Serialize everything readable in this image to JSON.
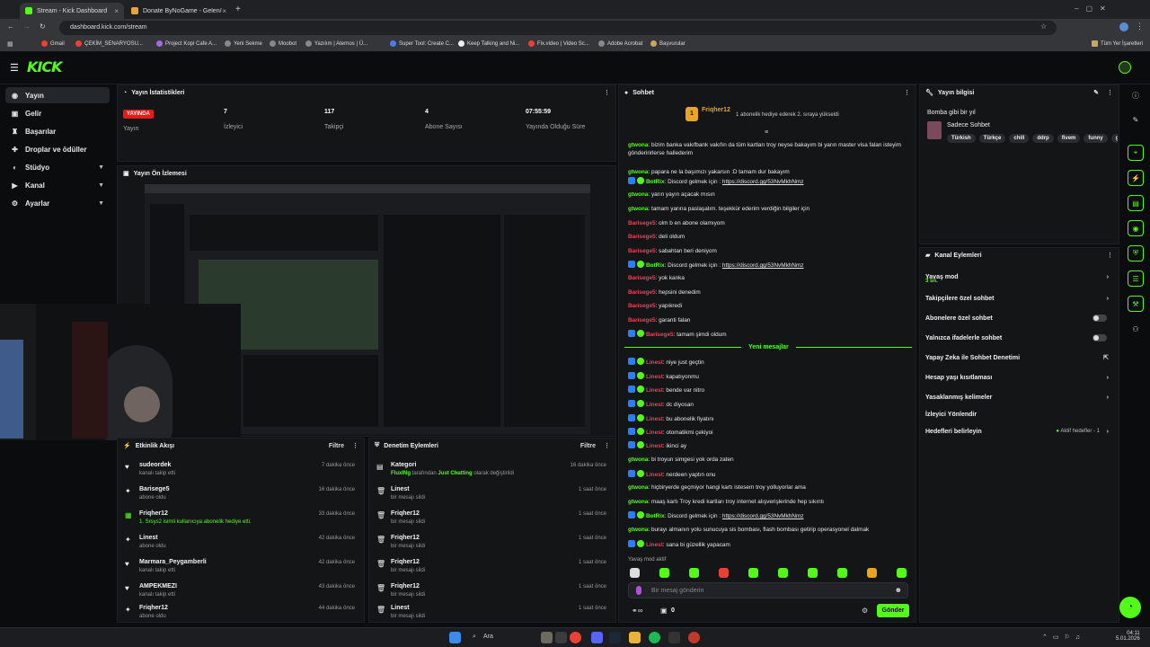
{
  "browser": {
    "tabs": [
      {
        "title": "Stream - Kick Dashboard",
        "active": true
      },
      {
        "title": "Donate ByNoGame - Gelen/Gid",
        "active": false
      }
    ],
    "url": "dashboard.kick.com/stream",
    "bookmarks": [
      "Gmail",
      "ÇEKİM_SENARYOSU...",
      "Project Kopi Cafe A...",
      "Yeni Sekme",
      "Moobot",
      "Yazılım | Aternos | Ü...",
      "Super Tool: Create C...",
      "Keep Talking and Ni...",
      "Fix.video | Video Sc...",
      "Adobe Acrobat",
      "Başvurular",
      "Tüm Yer İşaretleri"
    ]
  },
  "brand": {
    "logo": "KICK",
    "accent": "#53fc18"
  },
  "sidebar": {
    "items": [
      {
        "label": "Yayın",
        "icon": "broadcast-icon",
        "active": true
      },
      {
        "label": "Gelir",
        "icon": "wallet-icon"
      },
      {
        "label": "Başarılar",
        "icon": "trophy-icon"
      },
      {
        "label": "Droplar ve ödüller",
        "icon": "gift-icon"
      },
      {
        "label": "Stüdyo",
        "icon": "studio-icon",
        "expandable": true
      },
      {
        "label": "Kanal",
        "icon": "channel-icon",
        "expandable": true
      },
      {
        "label": "Ayarlar",
        "icon": "gear-icon",
        "expandable": true
      }
    ]
  },
  "stats": {
    "title": "Yayın İstatistikleri",
    "live_badge": "YAYINDA",
    "items": [
      {
        "value": "7",
        "label": "İzleyici"
      },
      {
        "value": "117",
        "label": "Takipçi"
      },
      {
        "value": "4",
        "label": "Abone Sayısı"
      },
      {
        "value": "07:55:59",
        "label": "Yayında Olduğu Süre"
      }
    ],
    "status_label": "Yayın"
  },
  "preview": {
    "title": "Yayın Ön İzlemesi"
  },
  "activity": {
    "title": "Etkinlik Akışı",
    "filter": "Filtre",
    "items": [
      {
        "icon": "heart-icon",
        "name": "sudeordek",
        "sub": "kanalı takip etti",
        "time": "7 dakika önce",
        "green": false
      },
      {
        "icon": "star-icon",
        "name": "Barisege5",
        "sub": "abone oldu",
        "time": "16 dakika önce",
        "green": false
      },
      {
        "icon": "gift-icon",
        "name": "Friqher12",
        "sub": "1. Srsys2 isimli kullanıcıya abonelik hediye etti.",
        "time": "33 dakika önce",
        "green": true
      },
      {
        "icon": "star-icon",
        "name": "Linest",
        "sub": "abone oldu",
        "time": "42 dakika önce",
        "green": false
      },
      {
        "icon": "heart-icon",
        "name": "Marmara_Peygamberli",
        "sub": "kanalı takip etti",
        "time": "42 dakika önce",
        "green": false
      },
      {
        "icon": "heart-icon",
        "name": "AMPEKMEZI",
        "sub": "kanalı takip etti",
        "time": "43 dakika önce",
        "green": false
      },
      {
        "icon": "star-icon",
        "name": "Friqher12",
        "sub": "abone oldu",
        "time": "44 dakika önce",
        "green": false
      }
    ]
  },
  "moderation": {
    "title": "Denetim Eylemleri",
    "filter": "Filtre",
    "items": [
      {
        "icon": "category-icon",
        "name": "Kategori",
        "sub_user": "FluxINg",
        "sub_mid": " tarafından ",
        "sub_cat": "Just Chatting",
        "sub_end": " olarak değiştirildi",
        "time": "16 dakika önce"
      },
      {
        "icon": "trash-icon",
        "name": "Linest",
        "sub": "bir mesajı sildi",
        "time": "1 saat önce"
      },
      {
        "icon": "trash-icon",
        "name": "Friqher12",
        "sub": "bir mesajı sildi",
        "time": "1 saat önce"
      },
      {
        "icon": "trash-icon",
        "name": "Friqher12",
        "sub": "bir mesajı sildi",
        "time": "1 saat önce"
      },
      {
        "icon": "trash-icon",
        "name": "Friqher12",
        "sub": "bir mesajı sildi",
        "time": "1 saat önce"
      },
      {
        "icon": "trash-icon",
        "name": "Friqher12",
        "sub": "bir mesajı sildi",
        "time": "1 saat önce"
      },
      {
        "icon": "trash-icon",
        "name": "Linest",
        "sub": "bir mesajı sildi",
        "time": "1 saat önce"
      }
    ]
  },
  "chat": {
    "title": "Sohbet",
    "pinned_user": "Friqher12",
    "pinned_count": "1",
    "pinned_text": "1 abonelik hediye ederek 2. sıraya yükseldi",
    "new_messages": "Yeni mesajlar",
    "slow_mode": "Yavaş mod aktif",
    "input_placeholder": "Bir mesaj gönderin",
    "send": "Gönder",
    "footer_count": "0",
    "messages": [
      {
        "user": "gtwona",
        "color": "#53fc18",
        "badges": [],
        "text": "bizim banka vakıfbank vakıfın da tüm kartları troy neyse bakayım bi yarın master visa falan isteyim gönderirirlerse hallederim"
      },
      {
        "user": "gtwona",
        "color": "#53fc18",
        "badges": [],
        "text": "papara ne la başımızı yakarsın :D tamam dur bakayım"
      },
      {
        "user": "BotRix",
        "color": "#53fc18",
        "badges": [
          "blue",
          "green"
        ],
        "text": "Discord gelmek için : ",
        "link": "https://discord.gg/53NvMkhNmz"
      },
      {
        "user": "gtwona",
        "color": "#53fc18",
        "badges": [],
        "text": "yarın yayın açacak mısın"
      },
      {
        "user": "gtwona",
        "color": "#53fc18",
        "badges": [],
        "text": "tamam yarına paslaşalım. teşekkür ederim verdiğin bilgiler için"
      },
      {
        "user": "Barisege5",
        "color": "#e9425b",
        "badges": [],
        "text": "olm b en abone olamıyom"
      },
      {
        "user": "Barisege5",
        "color": "#e9425b",
        "badges": [],
        "text": "deli oldum"
      },
      {
        "user": "Barisege5",
        "color": "#e9425b",
        "badges": [],
        "text": "sabahtan beri deniyom"
      },
      {
        "user": "BotRix",
        "color": "#53fc18",
        "badges": [
          "blue",
          "green"
        ],
        "text": "Discord gelmek için : ",
        "link": "https://discord.gg/53NvMkhNmz"
      },
      {
        "user": "Barisege5",
        "color": "#e9425b",
        "badges": [],
        "text": "yok kanka"
      },
      {
        "user": "Barisege5",
        "color": "#e9425b",
        "badges": [],
        "text": "hepsini denedim"
      },
      {
        "user": "Barisege5",
        "color": "#e9425b",
        "badges": [],
        "text": "yapıkredi"
      },
      {
        "user": "Barisege5",
        "color": "#e9425b",
        "badges": [],
        "text": "garanti falan"
      },
      {
        "user": "Barisege5",
        "color": "#e9425b",
        "badges": [
          "blue",
          "green"
        ],
        "text": "tamam şimdi oldum"
      },
      {
        "user": "Linest",
        "color": "#e9425b",
        "badges": [
          "blue",
          "green"
        ],
        "text": "niye just geçtin"
      },
      {
        "user": "Linest",
        "color": "#e9425b",
        "badges": [
          "blue",
          "green"
        ],
        "text": "kapatıyonmu"
      },
      {
        "user": "Linest",
        "color": "#e9425b",
        "badges": [
          "blue",
          "green"
        ],
        "text": "bende var nitro"
      },
      {
        "user": "Linest",
        "color": "#e9425b",
        "badges": [
          "blue",
          "green"
        ],
        "text": "dc diyosan"
      },
      {
        "user": "Linest",
        "color": "#e9425b",
        "badges": [
          "blue",
          "green"
        ],
        "text": "bu abonelik fiyatını"
      },
      {
        "user": "Linest",
        "color": "#e9425b",
        "badges": [
          "blue",
          "green"
        ],
        "text": "otomatikmi çekiyoi"
      },
      {
        "user": "Linest",
        "color": "#e9425b",
        "badges": [
          "blue",
          "green"
        ],
        "text": "ikinci ay"
      },
      {
        "user": "gtwona",
        "color": "#53fc18",
        "badges": [],
        "text": "bi troyun simgesi yok orda zaten"
      },
      {
        "user": "Linest",
        "color": "#e9425b",
        "badges": [
          "blue",
          "green"
        ],
        "text": "nerdeen yaptın onu"
      },
      {
        "user": "gtwona",
        "color": "#53fc18",
        "badges": [],
        "text": "hiçbiryerde geçmiyor hangi kartı istesem troy yolluyorlar ama"
      },
      {
        "user": "gtwona",
        "color": "#53fc18",
        "badges": [],
        "text": "maaş kartı Troy kredi kartları troy internet alışverişlerinde hep sıkıntı"
      },
      {
        "user": "BotRix",
        "color": "#53fc18",
        "badges": [
          "blue",
          "green"
        ],
        "text": "Discord gelmek için : ",
        "link": "https://discord.gg/53NvMkhNmz"
      },
      {
        "user": "gtwona",
        "color": "#53fc18",
        "badges": [],
        "text": "burayı almanın yolu sunucuya sis bombası, flash bombası getirip operasyonel dalmak"
      },
      {
        "user": "Linest",
        "color": "#e9425b",
        "badges": [
          "blue",
          "green"
        ],
        "text": "sana bi güzellik yapacam"
      }
    ]
  },
  "stream_info": {
    "title": "Yayın bilgisi",
    "stream_title": "Bomba gibi bir yıl",
    "category": "Sadece Sohbet",
    "tags": [
      "Türkish",
      "Türkçe",
      "chill",
      "ddrp",
      "fivem",
      "funny",
      "gar"
    ]
  },
  "channel_actions": {
    "title": "Kanal Eylemleri",
    "items": [
      {
        "label": "Yavaş mod",
        "sub": "3 sn.",
        "control": "arrow"
      },
      {
        "label": "Takipçilere özel sohbet",
        "control": "arrow"
      },
      {
        "label": "Abonelere özel sohbet",
        "control": "toggle"
      },
      {
        "label": "Yalnızca ifadelerle sohbet",
        "control": "toggle"
      },
      {
        "label": "Yapay Zeka ile Sohbet Denetimi",
        "control": "external"
      },
      {
        "label": "Hesap yaşı kısıtlaması",
        "control": "arrow"
      },
      {
        "label": "Yasaklanmış kelimeler",
        "control": "arrow"
      },
      {
        "label": "İzleyici Yönlendir",
        "control": "none"
      },
      {
        "label": "Hedefleri belirleyin",
        "control": "goal",
        "goal_text": "Aktif hedefler - 1"
      }
    ]
  },
  "taskbar": {
    "search": "Ara",
    "time": "04:11",
    "date": "5.01.2026"
  }
}
